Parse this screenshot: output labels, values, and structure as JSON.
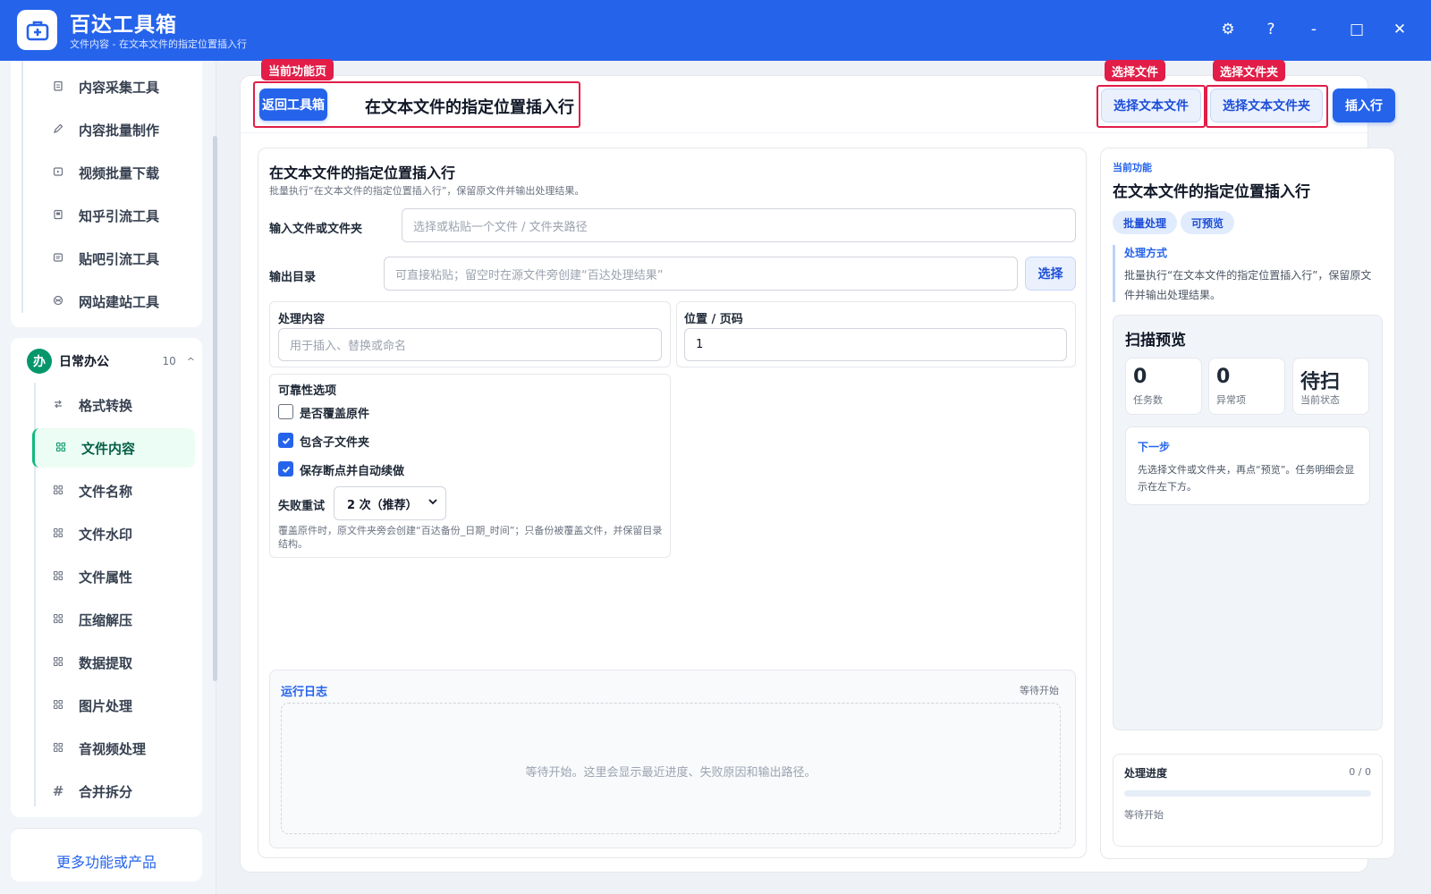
{
  "app": {
    "title": "百达工具箱",
    "subtitle": "文件内容 - 在文本文件的指定位置插入行"
  },
  "window_controls": {
    "settings": "⚙",
    "help": "?",
    "minimize": "-",
    "maximize": "□",
    "close": "✕"
  },
  "sidebar": {
    "top_items": [
      {
        "icon": "clipboard-icon",
        "label": "内容采集工具"
      },
      {
        "icon": "pencil-icon",
        "label": "内容批量制作"
      },
      {
        "icon": "video-icon",
        "label": "视频批量下载"
      },
      {
        "icon": "book-icon",
        "label": "知乎引流工具"
      },
      {
        "icon": "note-icon",
        "label": "贴吧引流工具"
      },
      {
        "icon": "globe-icon",
        "label": "网站建站工具"
      }
    ],
    "group": {
      "badge": "办",
      "label": "日常办公",
      "count": "10",
      "chevron": "^"
    },
    "group_items": [
      {
        "icon": "swap-icon",
        "label": "格式转换",
        "active": false
      },
      {
        "icon": "grid-icon",
        "label": "文件内容",
        "active": true
      },
      {
        "icon": "grid-icon",
        "label": "文件名称",
        "active": false
      },
      {
        "icon": "grid-icon",
        "label": "文件水印",
        "active": false
      },
      {
        "icon": "grid-icon",
        "label": "文件属性",
        "active": false
      },
      {
        "icon": "grid-icon",
        "label": "压缩解压",
        "active": false
      },
      {
        "icon": "grid-icon",
        "label": "数据提取",
        "active": false
      },
      {
        "icon": "grid-icon",
        "label": "图片处理",
        "active": false
      },
      {
        "icon": "grid-icon",
        "label": "音视频处理",
        "active": false
      },
      {
        "icon": "hash-icon",
        "label": "合并拆分",
        "active": false
      }
    ],
    "more": "更多功能或产品"
  },
  "toolbar": {
    "back": "返回工具箱",
    "title": "在文本文件的指定位置插入行",
    "select_file": "选择文本文件",
    "select_folder": "选择文本文件夹",
    "insert": "插入行"
  },
  "annotations": {
    "current_page": "当前功能页",
    "select_file": "选择文件",
    "select_folder": "选择文件夹"
  },
  "form": {
    "title": "在文本文件的指定位置插入行",
    "description": "批量执行“在文本文件的指定位置插入行”，保留原文件并输出处理结果。",
    "input_label": "输入文件或文件夹",
    "input_placeholder": "选择或粘贴一个文件 / 文件夹路径",
    "output_label": "输出目录",
    "output_placeholder": "可直接粘贴；留空时在源文件旁创建“百达处理结果”",
    "output_button": "选择",
    "content_label": "处理内容",
    "content_placeholder": "用于插入、替换或命名",
    "position_label": "位置 / 页码",
    "position_value": "1",
    "reliability_label": "可靠性选项",
    "options": [
      {
        "label": "是否覆盖原件",
        "checked": false
      },
      {
        "label": "包含子文件夹",
        "checked": true
      },
      {
        "label": "保存断点并自动续做",
        "checked": true
      }
    ],
    "retry_label": "失败重试",
    "retry_value": "2 次（推荐）",
    "note": "覆盖原件时，原文件夹旁会创建“百达备份_日期_时间”；只备份被覆盖文件，并保留目录结构。"
  },
  "log": {
    "title": "运行日志",
    "status": "等待开始",
    "placeholder": "等待开始。这里会显示最近进度、失败原因和输出路径。"
  },
  "side": {
    "caption": "当前功能",
    "title": "在文本文件的指定位置插入行",
    "tags": [
      "批量处理",
      "可预览"
    ],
    "method_label": "处理方式",
    "method_text": "批量执行“在文本文件的指定位置插入行”，保留原文件并输出处理结果。",
    "scan_title": "扫描预览",
    "stats": [
      {
        "value": "0",
        "caption": "任务数"
      },
      {
        "value": "0",
        "caption": "异常项"
      },
      {
        "value": "待扫",
        "caption": "当前状态"
      }
    ],
    "next_label": "下一步",
    "next_text": "先选择文件或文件夹，再点“预览”。任务明细会显示在左下方。",
    "progress_label": "处理进度",
    "progress_count": "0 / 0",
    "progress_fraction": 0,
    "progress_status": "等待开始"
  }
}
